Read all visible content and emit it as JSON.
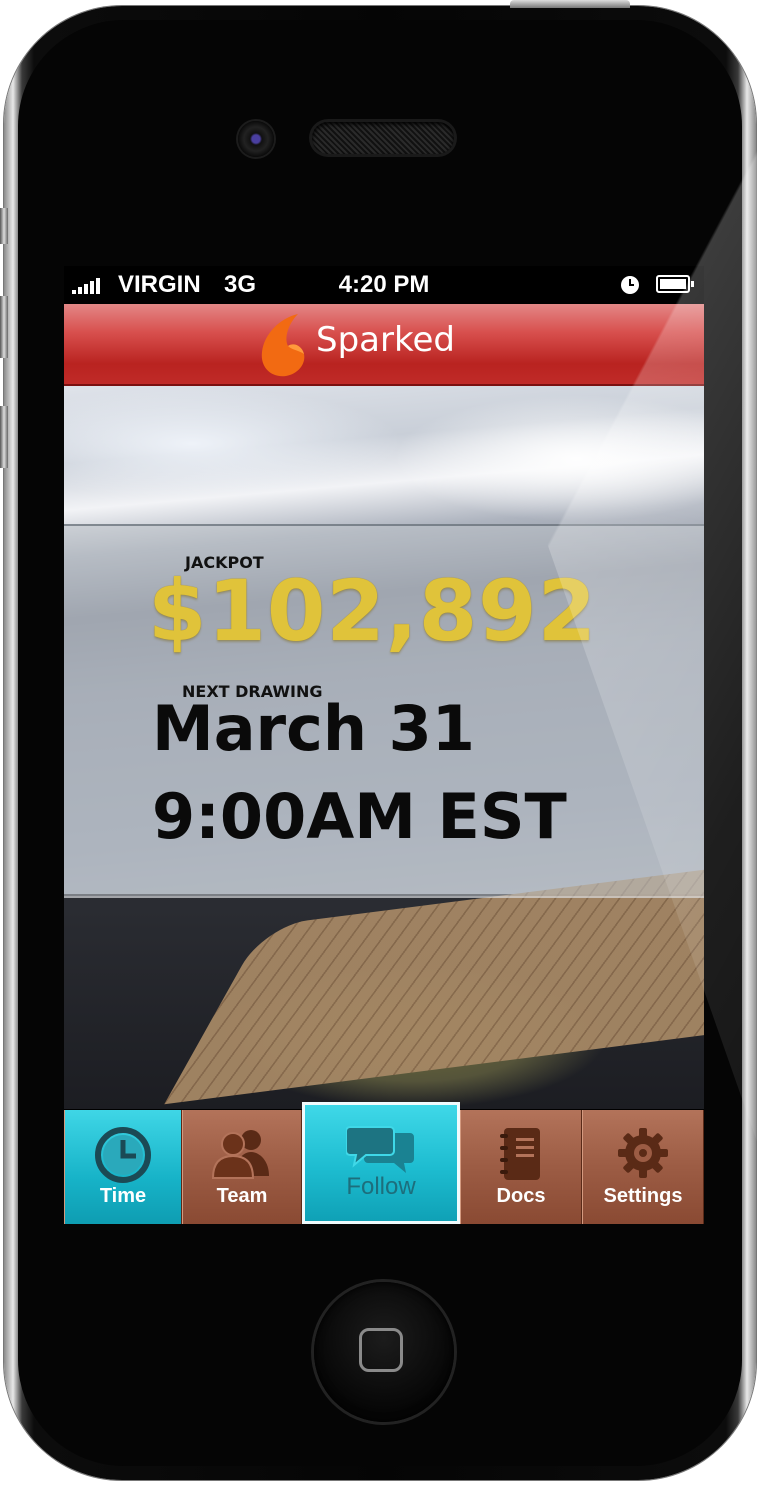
{
  "status_bar": {
    "carrier": "VIRGIN",
    "network": "3G",
    "time": "4:20 PM",
    "icons": [
      "signal-icon",
      "alarm-icon",
      "battery-icon"
    ]
  },
  "app_bar": {
    "title": "Sparked",
    "logo": "flame-icon"
  },
  "jackpot": {
    "label": "JACKPOT",
    "amount": "$102,892"
  },
  "next_drawing": {
    "label": "NEXT DRAWING",
    "date": "March 31",
    "time": "9:00AM EST"
  },
  "tabs": [
    {
      "label": "Time",
      "icon": "clock-icon",
      "state": "highlighted"
    },
    {
      "label": "Team",
      "icon": "people-icon",
      "state": "normal"
    },
    {
      "label": "Follow",
      "icon": "chat-bubbles-icon",
      "state": "selected"
    },
    {
      "label": "Docs",
      "icon": "notebook-icon",
      "state": "normal"
    },
    {
      "label": "Settings",
      "icon": "gear-icon",
      "state": "normal"
    }
  ],
  "colors": {
    "app_bar_red": "#c02b28",
    "jackpot_gold": "#e0c33a",
    "tab_active_cyan": "#1dbcd0",
    "tab_brown": "#9c5c44"
  }
}
